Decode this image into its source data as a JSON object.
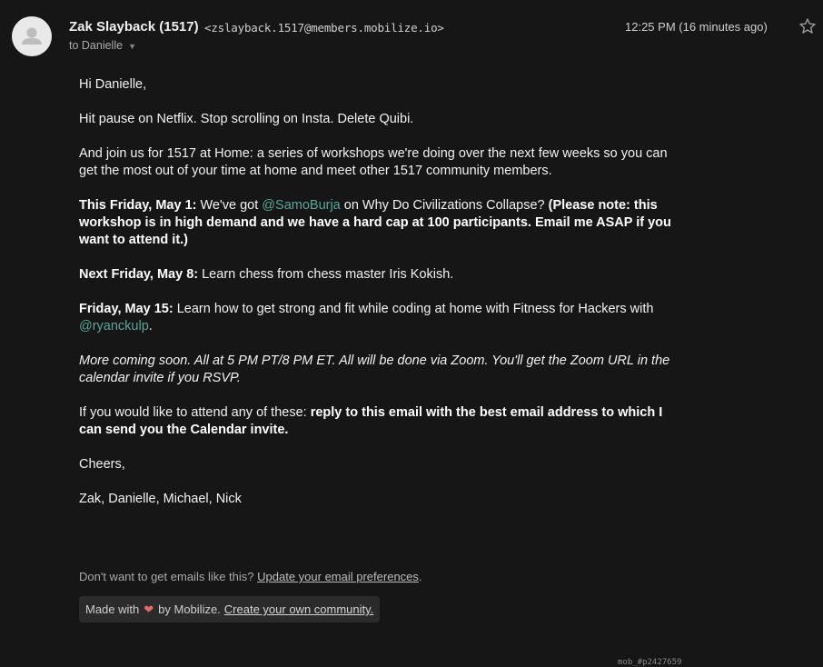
{
  "header": {
    "sender_name": "Zak Slayback (1517)",
    "sender_email": "<zslayback.1517@members.mobilize.io>",
    "to_label": "to Danielle",
    "timestamp": "12:25 PM (16 minutes ago)"
  },
  "body": {
    "greeting": "Hi Danielle,",
    "intro": "Hit pause on Netflix. Stop scrolling on Insta. Delete Quibi.",
    "join": "And join us for 1517 at Home: a series of workshops we're doing over the next few weeks so you can get the most out of your time at home and meet other 1517 community members.",
    "event1": {
      "lead": "This Friday, May 1:",
      "text_before": " We've got ",
      "mention": "@SamoBurja",
      "text_after": " on Why Do Civilizations Collapse? ",
      "note": "(Please note: this workshop is in high demand and we have a hard cap at 100 participants. Email me ASAP if you want to attend it.)"
    },
    "event2": {
      "lead": "Next Friday, May 8:",
      "text": " Learn chess from chess master Iris Kokish."
    },
    "event3": {
      "lead": "Friday, May 15:",
      "text": " Learn how to get strong and fit while coding at home with Fitness for Hackers with ",
      "mention": "@ryanckulp",
      "end": "."
    },
    "more": "More coming soon. All at 5 PM PT/8 PM ET. All will be done via Zoom. You'll get the Zoom URL in the calendar invite if you RSVP.",
    "attend": {
      "text": "If you would like to attend any of these: ",
      "bold": "reply to this email with the best email address to which I can send you the Calendar invite."
    },
    "signoff": "Cheers,",
    "signature": "Zak, Danielle, Michael, Nick"
  },
  "footer": {
    "prefs_text": "Don't want to get emails like this? ",
    "prefs_link": "Update your email preferences",
    "prefs_end": ".",
    "made_with": "Made with",
    "by_mobilize": "by Mobilize.",
    "create_link": "Create your own community.",
    "tracking": "mob_#p2427659"
  },
  "colors": {
    "background": "#161616",
    "link": "#5aa69a",
    "heart": "#e06a6a"
  },
  "icons": [
    "avatar-placeholder-icon",
    "star-icon",
    "chevron-down-icon",
    "heart-icon"
  ]
}
